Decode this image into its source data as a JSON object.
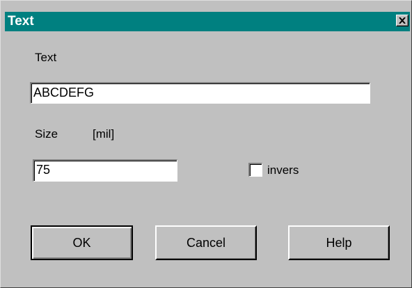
{
  "window": {
    "title": "Text"
  },
  "labels": {
    "text": "Text",
    "size": "Size",
    "unit": "[mil]",
    "invers": "invers"
  },
  "fields": {
    "text_value": "ABCDEFG",
    "size_value": "75"
  },
  "checkbox": {
    "invers_checked": false
  },
  "buttons": {
    "ok": "OK",
    "cancel": "Cancel",
    "help": "Help"
  },
  "colors": {
    "titlebar": "#008080",
    "face": "#c0c0c0"
  },
  "icons": {
    "close": "close-icon"
  }
}
